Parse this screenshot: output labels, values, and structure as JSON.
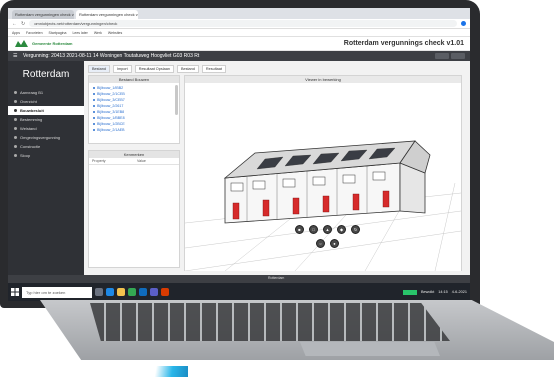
{
  "browser": {
    "tabs": [
      {
        "label": "Rotterdam vergunningen check v1.01"
      },
      {
        "label": "Rotterdam vergunningen check v1.01"
      }
    ],
    "url": "omniobjects.net/rotterdam/vergunningen/check",
    "bookmarks": [
      "Apps",
      "Favorieten",
      "Startpagina",
      "Lees later",
      "Werk",
      "Websites"
    ]
  },
  "app": {
    "logo_text": "Gemeente Rotterdam",
    "title": "Rotterdam vergunnings check v1.01",
    "subheader": "Vergunning:  20413 2021-08-11 14 Woningen Toutatuweg Hoogvliet G03 R03 Rt",
    "footer_info": "Rotterdam"
  },
  "sidebar": {
    "city": "Rotterdam",
    "items": [
      {
        "label": "Aanvraag B1"
      },
      {
        "label": "Overzicht"
      },
      {
        "label": "Bouwbesluit"
      },
      {
        "label": "Bestemming"
      },
      {
        "label": "Welstand"
      },
      {
        "label": "Omgevingsvergunning"
      },
      {
        "label": "Constructie"
      },
      {
        "label": "Sloop"
      }
    ]
  },
  "toolbar": {
    "buttons": [
      {
        "label": "Bestand"
      },
      {
        "label": "Import"
      },
      {
        "label": "Resultaat Opslaan"
      },
      {
        "label": "Bestand"
      },
      {
        "label": "Resultaat"
      }
    ]
  },
  "files": {
    "header": "Bestand Bouwen",
    "items": [
      "Bijlbouw_1/IBB2",
      "Bijlbouw_2/1CEB",
      "Bijlbouw_3/CEB7",
      "Bijlbouw_2/2617",
      "Bijlbouw_3/1EB8",
      "Bijlbouw_1/BBE8",
      "Bijlbouw_1/2BCE",
      "Bijlbouw_2/1AEB"
    ]
  },
  "kenmerken": {
    "header": "Kenmerken",
    "columns": [
      "Property",
      "Value"
    ]
  },
  "viewer": {
    "header": "Viewer in bewerking"
  },
  "taskbar": {
    "search_placeholder": "Typ hier om te zoeken",
    "tray_text": "Bewolkt",
    "time": "14:15",
    "date": "4-6-2021"
  },
  "colors": {
    "sidebar_bg": "#2f3136",
    "accent_link": "#2a6fcf",
    "brand_green": "#2b8a3e",
    "door_red": "#d62b2b",
    "taskbar": "#20242b"
  }
}
